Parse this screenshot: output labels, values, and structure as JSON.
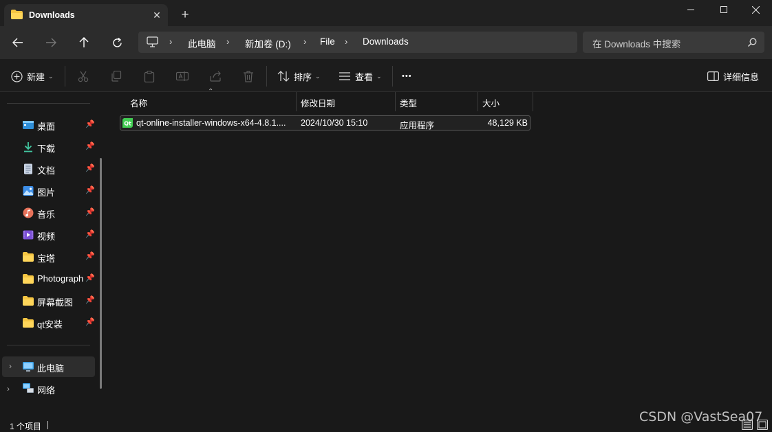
{
  "tab": {
    "title": "Downloads",
    "close_glyph": "✕",
    "new_tab_glyph": "+"
  },
  "address": {
    "root_icon": "computer-icon",
    "crumbs": [
      "此电脑",
      "新加卷 (D:)",
      "File",
      "Downloads"
    ]
  },
  "search": {
    "placeholder": "在 Downloads 中搜索"
  },
  "commands": {
    "new_label": "新建",
    "sort_label": "排序",
    "view_label": "查看",
    "more_glyph": "•••",
    "details_label": "详细信息"
  },
  "sidebar": {
    "pinned": [
      {
        "label": "桌面",
        "icon": "desktop-icon"
      },
      {
        "label": "下载",
        "icon": "download-icon"
      },
      {
        "label": "文档",
        "icon": "document-icon"
      },
      {
        "label": "图片",
        "icon": "picture-icon"
      },
      {
        "label": "音乐",
        "icon": "music-icon"
      },
      {
        "label": "视频",
        "icon": "video-icon"
      },
      {
        "label": "宝塔",
        "icon": "folder-icon"
      },
      {
        "label": "Photograph",
        "icon": "folder-icon"
      },
      {
        "label": "屏幕截图",
        "icon": "folder-icon"
      },
      {
        "label": "qt安装",
        "icon": "folder-icon"
      }
    ],
    "locations": [
      {
        "label": "此电脑",
        "icon": "this-pc-icon"
      },
      {
        "label": "网络",
        "icon": "network-icon"
      }
    ]
  },
  "columns": {
    "name": "名称",
    "modified": "修改日期",
    "type": "类型",
    "size": "大小"
  },
  "files": [
    {
      "name": "qt-online-installer-windows-x64-4.8.1....",
      "modified": "2024/10/30 15:10",
      "type": "应用程序",
      "size": "48,129 KB",
      "icon": "qt-app-icon"
    }
  ],
  "status": {
    "item_count": "1 个项目"
  },
  "watermark": "CSDN @VastSea07",
  "colors": {
    "folder": "#f5c542",
    "accent": "#4cc2ff",
    "qt_green": "#41cd52"
  }
}
